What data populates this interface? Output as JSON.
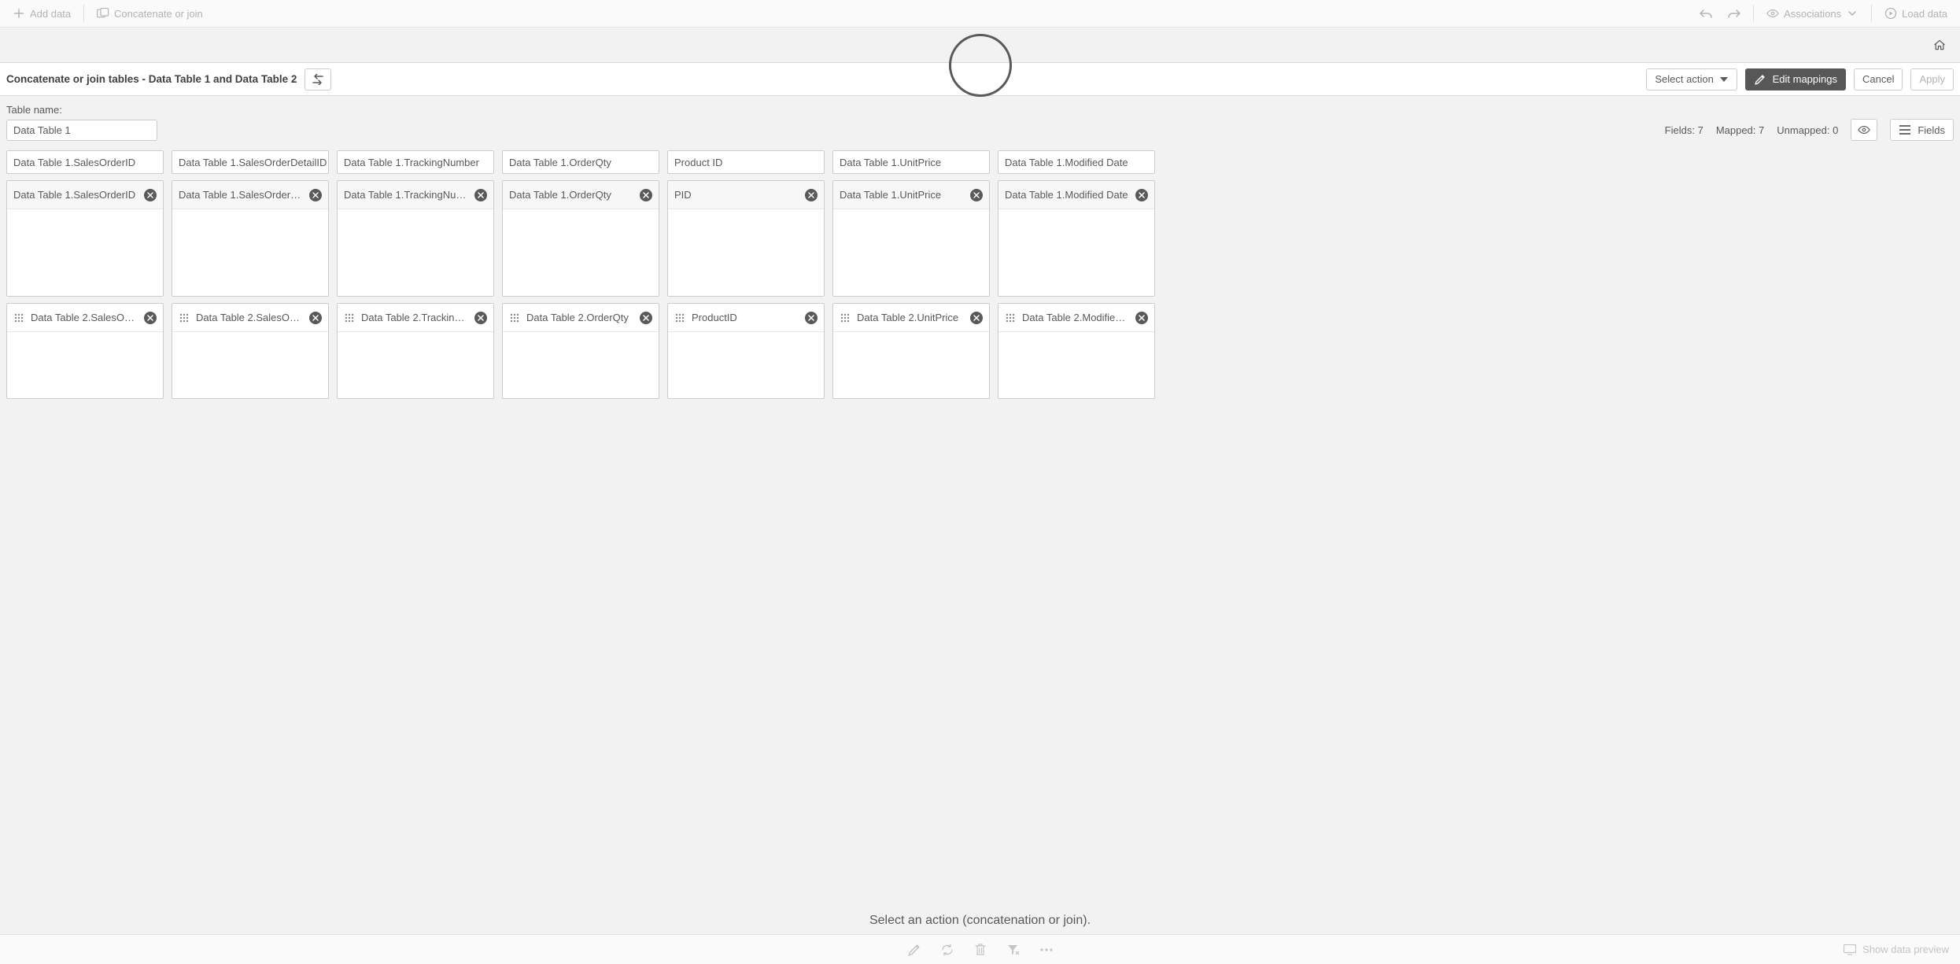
{
  "toolbar": {
    "add_data": "Add data",
    "concat_join": "Concatenate or join",
    "associations": "Associations",
    "load_data": "Load data"
  },
  "action_bar": {
    "title": "Concatenate or join tables - Data Table 1 and Data Table 2",
    "select_action": "Select action",
    "edit_mappings": "Edit mappings",
    "cancel": "Cancel",
    "apply": "Apply"
  },
  "workspace": {
    "table_name_label": "Table name:",
    "table_name_value": "Data Table 1",
    "fields_label": "Fields: ",
    "fields_count": 7,
    "mapped_label": "Mapped: ",
    "mapped_count": 7,
    "unmapped_label": "Unmapped: ",
    "unmapped_count": 0,
    "fields_button": "Fields",
    "columns": [
      {
        "header": "Data Table 1.SalesOrderID",
        "row1": "Data Table 1.SalesOrderID",
        "row2": "Data Table 2.SalesOr…"
      },
      {
        "header": "Data Table 1.SalesOrderDetailID",
        "row1": "Data Table 1.SalesOrder…",
        "row2": "Data Table 2.SalesOr…"
      },
      {
        "header": "Data Table 1.TrackingNumber",
        "row1": "Data Table 1.TrackingNu…",
        "row2": "Data Table 2.Trackin…"
      },
      {
        "header": "Data Table 1.OrderQty",
        "row1": "Data Table 1.OrderQty",
        "row2": "Data Table 2.OrderQty"
      },
      {
        "header": "Product ID",
        "row1": "PID",
        "row2": "ProductID"
      },
      {
        "header": "Data Table 1.UnitPrice",
        "row1": "Data Table 1.UnitPrice",
        "row2": "Data Table 2.UnitPrice"
      },
      {
        "header": "Data Table 1.Modified Date",
        "row1": "Data Table 1.Modified Date",
        "row2": "Data Table 2.Modifie…"
      }
    ],
    "prompt": "Select an action (concatenation or join)."
  },
  "footer": {
    "show_preview": "Show data preview"
  }
}
